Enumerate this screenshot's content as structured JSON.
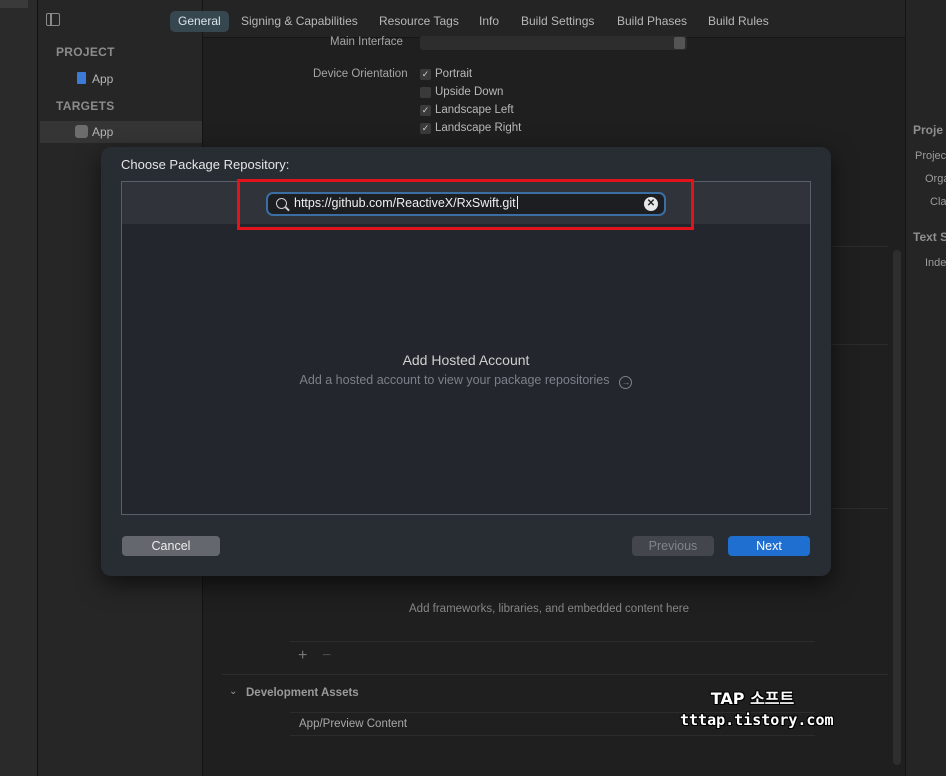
{
  "window": {
    "tabs": [
      "General",
      "Signing & Capabilities",
      "Resource Tags",
      "Info",
      "Build Settings",
      "Build Phases",
      "Build Rules"
    ],
    "active_tab": "General"
  },
  "navigator": {
    "project_header": "PROJECT",
    "project_item": "App",
    "targets_header": "TARGETS",
    "target_item": "App"
  },
  "general": {
    "main_interface_label": "Main Interface",
    "device_orientation_label": "Device Orientation",
    "orientations": [
      {
        "label": "Portrait",
        "checked": true
      },
      {
        "label": "Upside Down",
        "checked": false
      },
      {
        "label": "Landscape Left",
        "checked": true
      },
      {
        "label": "Landscape Right",
        "checked": true
      }
    ],
    "frameworks_empty": "Add frameworks, libraries, and embedded content here",
    "add_symbol": "+",
    "remove_symbol": "−",
    "dev_assets_header": "Development Assets",
    "dev_assets_item": "App/Preview Content"
  },
  "inspector": {
    "lines": [
      "Proje",
      "Projec",
      "Orga",
      "Cla",
      "Text S",
      "Inde"
    ]
  },
  "dialog": {
    "title": "Choose Package Repository:",
    "search_value": "https://github.com/ReactiveX/RxSwift.git",
    "empty_title": "Add Hosted Account",
    "empty_subtitle": "Add a hosted account to view your package repositories",
    "cancel_label": "Cancel",
    "previous_label": "Previous",
    "next_label": "Next"
  },
  "watermark": {
    "line1": "TAP 소프트",
    "line2": "tttap.tistory.com"
  }
}
